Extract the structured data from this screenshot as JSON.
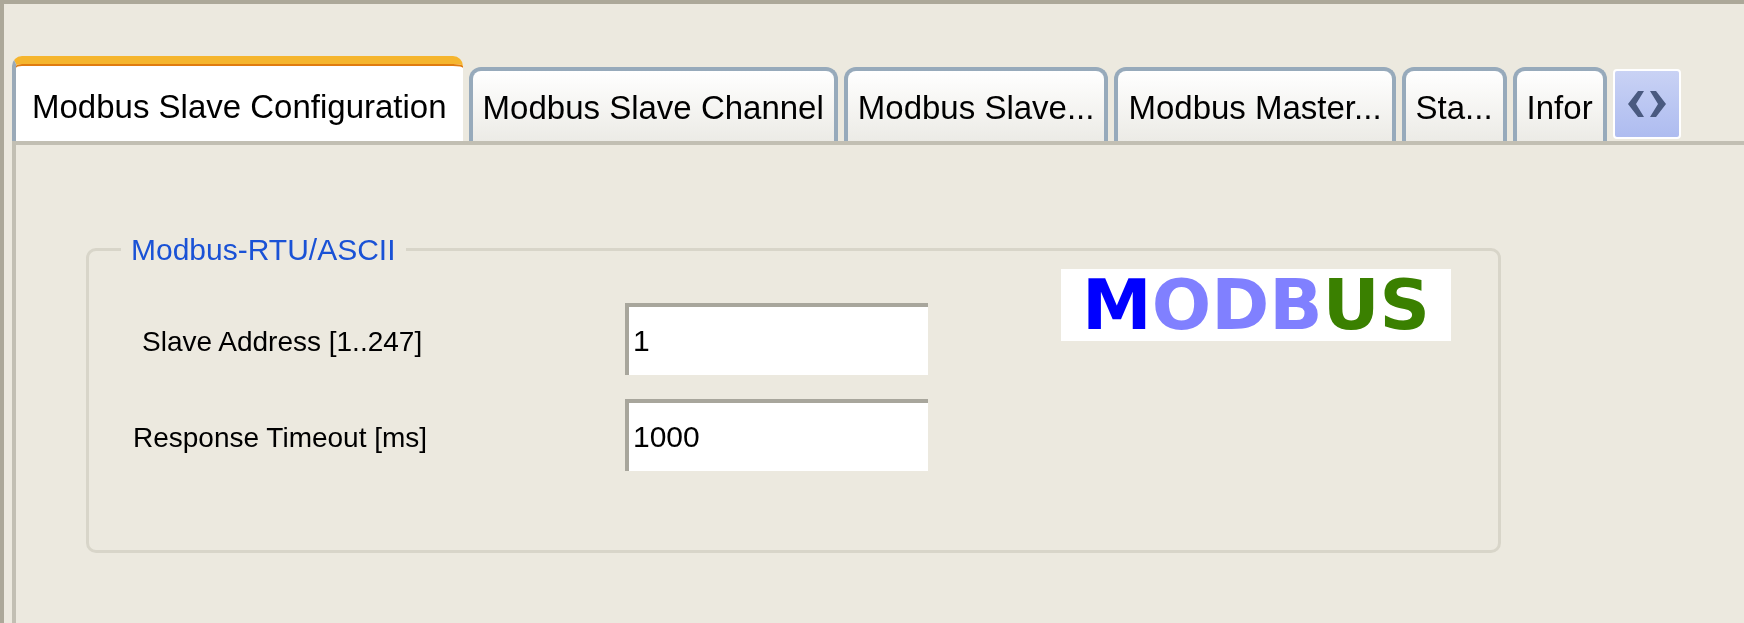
{
  "tabs": [
    {
      "label": "Modbus Slave Configuration",
      "selected": true
    },
    {
      "label": "Modbus Slave Channel",
      "selected": false
    },
    {
      "label": "Modbus Slave...",
      "selected": false
    },
    {
      "label": "Modbus Master...",
      "selected": false
    },
    {
      "label": "Sta...",
      "selected": false
    },
    {
      "label": "Infor",
      "selected": false
    }
  ],
  "group": {
    "title": "Modbus-RTU/ASCII",
    "fields": [
      {
        "label": "Slave Address [1..247]",
        "value": "1"
      },
      {
        "label": "Response Timeout [ms]",
        "value": "1000"
      }
    ],
    "logo": [
      {
        "text": "M",
        "color": "#0000ff"
      },
      {
        "text": "ODB",
        "color": "#8080ff"
      },
      {
        "text": "US",
        "color": "#3a8000"
      }
    ]
  }
}
